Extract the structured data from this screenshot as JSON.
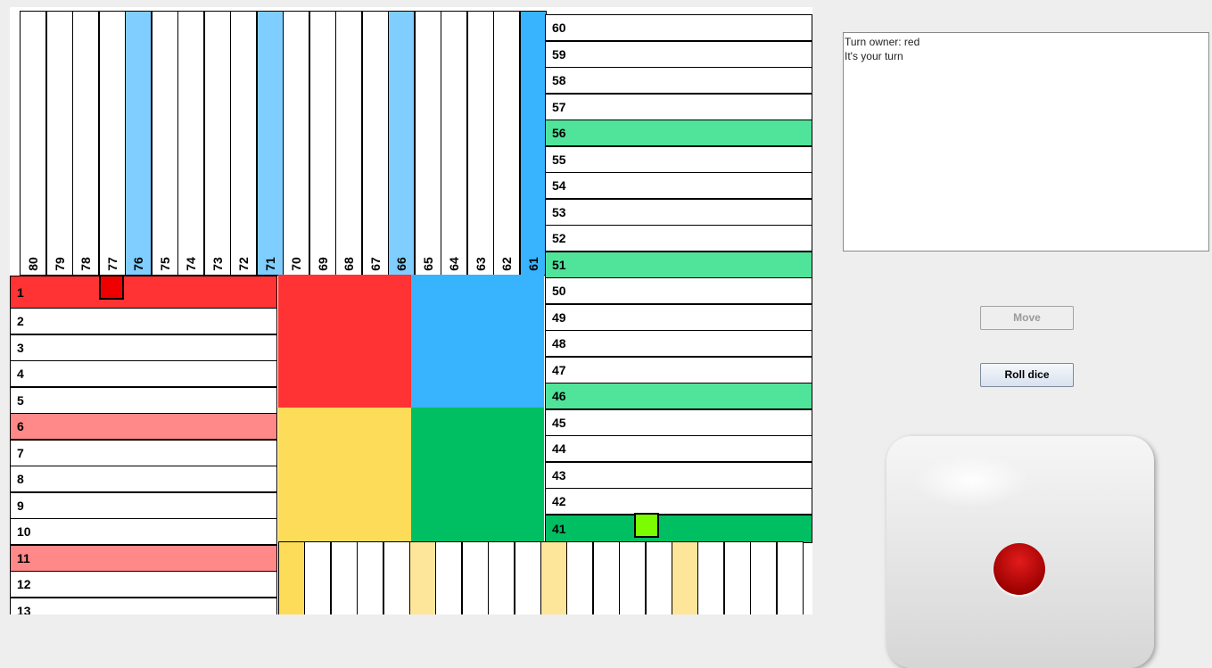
{
  "board": {
    "top_column_numbers": [
      "80",
      "79",
      "78",
      "77",
      "76",
      "75",
      "74",
      "73",
      "72",
      "71",
      "70",
      "69",
      "68",
      "67",
      "66",
      "65",
      "64",
      "63",
      "62",
      "61"
    ],
    "right_column_numbers": [
      "60",
      "59",
      "58",
      "57",
      "56",
      "55",
      "54",
      "53",
      "52",
      "51",
      "50",
      "49",
      "48",
      "47",
      "46",
      "45",
      "44",
      "43",
      "42",
      "41"
    ],
    "left_column_numbers": [
      "1",
      "2",
      "3",
      "4",
      "5",
      "6",
      "7",
      "8",
      "9",
      "10",
      "11",
      "12",
      "13"
    ],
    "bottom_column_count": 20,
    "colors": {
      "red": "#ff3333",
      "red_safe": "#ff8888",
      "blue": "#38b4ff",
      "blue_safe": "#80ceff",
      "green": "#00bf63",
      "green_safe": "#50e39a",
      "yellow": "#fddc5a",
      "yellow_safe": "#fde69a"
    },
    "pieces": [
      {
        "name": "red-piece",
        "color": "#ee0000",
        "square": "1"
      },
      {
        "name": "green-piece",
        "color": "#7cfc00",
        "square": "41"
      }
    ]
  },
  "log": {
    "lines": [
      "Turn owner: red",
      "It's your turn"
    ]
  },
  "controls": {
    "move_label": "Move",
    "roll_label": "Roll dice"
  },
  "dice": {
    "value_shown": 1,
    "pip_color": "#cc0000"
  }
}
